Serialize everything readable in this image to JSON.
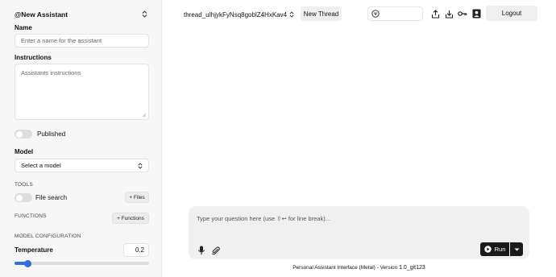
{
  "sidebar": {
    "assistant_select": "@New Assistant",
    "name_label": "Name",
    "name_placeholder": "Enter a name for the assistant",
    "instructions_label": "Instructions",
    "instructions_placeholder": "Assistants instructions",
    "published_label": "Published",
    "published": false,
    "model_label": "Model",
    "model_select": "Select a model",
    "tools_heading": "TOOLS",
    "file_search_label": "File search",
    "file_search": false,
    "files_button": "+ Files",
    "functions_heading": "FUNCTIONS",
    "functions_button": "+ Functions",
    "model_config_heading": "MODEL CONFIGURATION",
    "temperature_label": "Temperature",
    "temperature_value": "0.2",
    "temperature_fraction": 0.1
  },
  "header": {
    "thread_select": "thread_uIhjykFyNsq8goblZ4HxKav4",
    "new_thread_button": "New Thread",
    "logout_button": "Logout",
    "icons": [
      "filter-icon",
      "upload-icon",
      "download-icon",
      "key-icon",
      "contact-icon"
    ]
  },
  "composer": {
    "placeholder": "Type your question here (use ⇧↩ for line break)...",
    "run_button": "Run",
    "icons": [
      "microphone-icon",
      "paperclip-icon",
      "play-icon",
      "caret-down-icon"
    ]
  },
  "footer": {
    "text": "Personal Assistant Interface (Metal) - Version",
    "version": "1.0_git123"
  },
  "colors": {
    "accent": "#2f6fe0",
    "run_button": "#1a1a1a",
    "sidebar_bg": "#f7f7f7"
  }
}
